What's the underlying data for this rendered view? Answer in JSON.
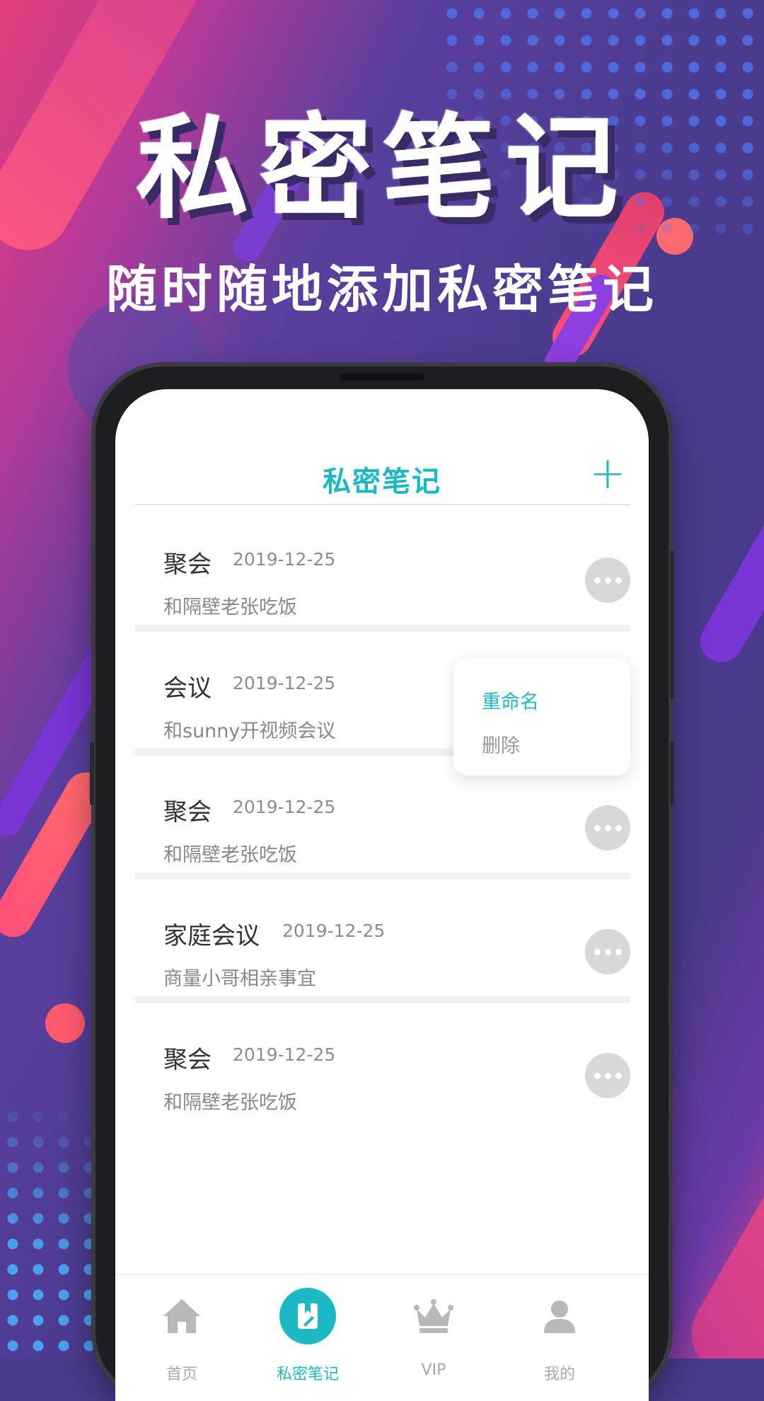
{
  "promo": {
    "headline": "私密笔记",
    "subline": "随时随地添加私密笔记"
  },
  "app": {
    "title": "私密笔记",
    "add_icon": "plus-icon",
    "accent_color": "#1cb8c4"
  },
  "notes": [
    {
      "title": "聚会",
      "date": "2019-12-25",
      "desc": "和隔壁老张吃饭"
    },
    {
      "title": "会议",
      "date": "2019-12-25",
      "desc": "和sunny开视频会议"
    },
    {
      "title": "聚会",
      "date": "2019-12-25",
      "desc": "和隔壁老张吃饭"
    },
    {
      "title": "家庭会议",
      "date": "2019-12-25",
      "desc": "商量小哥相亲事宜"
    },
    {
      "title": "聚会",
      "date": "2019-12-25",
      "desc": "和隔壁老张吃饭"
    }
  ],
  "popup_menu": {
    "rename": "重命名",
    "delete": "删除"
  },
  "tabs": [
    {
      "label": "首页",
      "icon": "home-icon"
    },
    {
      "label": "私密笔记",
      "icon": "notes-icon",
      "active": true
    },
    {
      "label": "VIP",
      "icon": "crown-icon"
    },
    {
      "label": "我的",
      "icon": "user-icon"
    }
  ]
}
